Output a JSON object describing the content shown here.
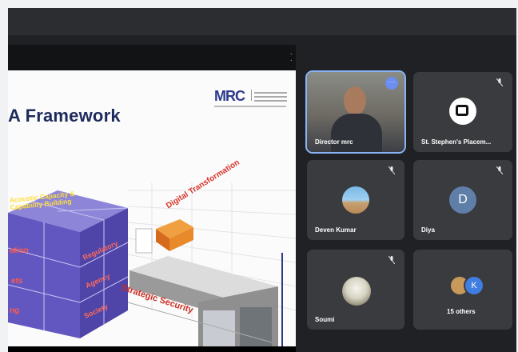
{
  "slide": {
    "title": "A Framework",
    "logo_text": "MRC",
    "cube_top_label": "Acoustic Capacity & Capability Building",
    "cube_side_labels": [
      "ation",
      "ets",
      "ng"
    ],
    "cube_right_labels": [
      "Regulatory",
      "Agency",
      "Society"
    ],
    "digital_label": "Digital Transformation",
    "strategic_label": "Strategic Security"
  },
  "participants": [
    {
      "name": "Director mrc",
      "type": "video",
      "active": true
    },
    {
      "name": "St. Stephen's Placem...",
      "type": "logo",
      "muted": true
    },
    {
      "name": "Deven Kumar",
      "type": "photo",
      "muted": true
    },
    {
      "name": "Diya",
      "type": "letter",
      "letter": "D",
      "color": "#5f7fa8",
      "muted": true
    },
    {
      "name": "Soumi",
      "type": "photo",
      "muted": true
    },
    {
      "name": "15 others",
      "type": "others",
      "letter": "K",
      "color": "#3f7de0"
    }
  ],
  "icons": {
    "mic_off": "mic-off-icon",
    "more": "more-options-icon"
  }
}
